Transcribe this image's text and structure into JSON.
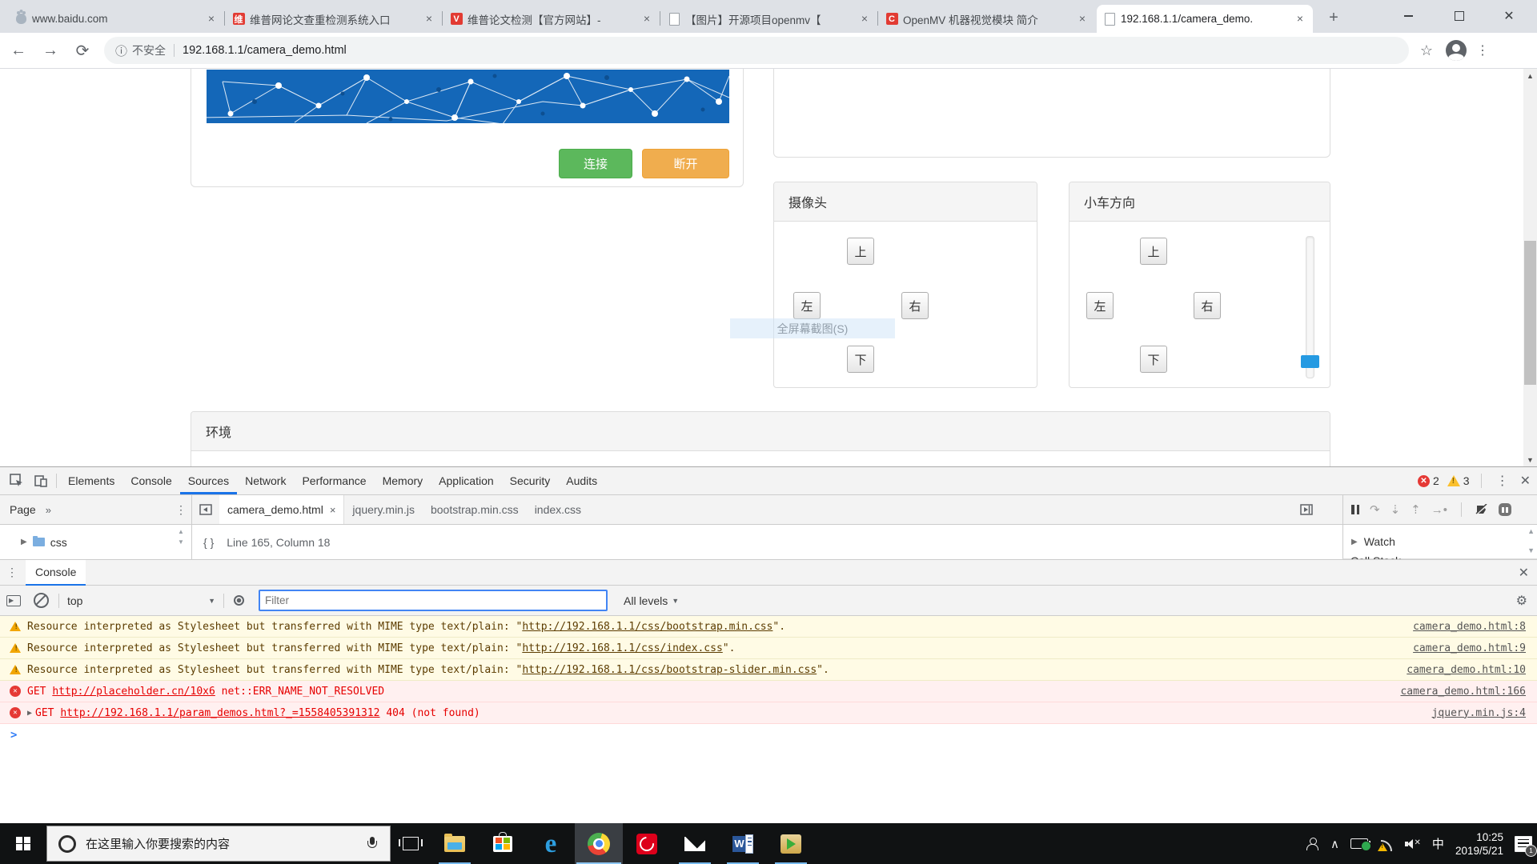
{
  "browser": {
    "tabs": [
      {
        "title": "www.baidu.com",
        "fav": ""
      },
      {
        "title": "维普网论文查重检测系统入口",
        "fav": "维"
      },
      {
        "title": "维普论文检测【官方网站】-",
        "fav": "V"
      },
      {
        "title": "【图片】开源项目openmv【",
        "fav": ""
      },
      {
        "title": "OpenMV 机器视觉模块 简介",
        "fav": "C"
      },
      {
        "title": "192.168.1.1/camera_demo.",
        "fav": ""
      }
    ],
    "address": {
      "security_label": "不安全",
      "url": "192.168.1.1/camera_demo.html"
    }
  },
  "page": {
    "connect_card": {
      "connect_label": "连接",
      "disconnect_label": "断开"
    },
    "camera_panel": {
      "title": "摄像头",
      "up": "上",
      "left": "左",
      "right": "右",
      "down": "下"
    },
    "car_panel": {
      "title": "小车方向",
      "up": "上",
      "left": "左",
      "right": "右",
      "down": "下"
    },
    "env_panel": {
      "title": "环境"
    },
    "ghost_tooltip": "全屏幕截图(S)"
  },
  "devtools": {
    "tabs": [
      "Elements",
      "Console",
      "Sources",
      "Network",
      "Performance",
      "Memory",
      "Application",
      "Security",
      "Audits"
    ],
    "error_count": "2",
    "warning_count": "3",
    "navigator": {
      "pane_tab": "Page",
      "more_chevron": "»",
      "tree_item": "css"
    },
    "file_tabs": [
      "camera_demo.html",
      "jquery.min.js",
      "bootstrap.min.css",
      "index.css"
    ],
    "editor_status": "Line 165, Column 18",
    "watch_label": "Watch",
    "callstack_label": "Call Stack",
    "drawer_tab": "Console",
    "console_toolbar": {
      "context": "top",
      "filter_placeholder": "Filter",
      "levels": "All levels"
    },
    "messages": [
      {
        "type": "warning",
        "before": "Resource interpreted as Stylesheet but transferred with MIME type text/plain: \"",
        "link": "http://192.168.1.1/css/bootstrap.min.css",
        "after": "\".",
        "source": "camera_demo.html:8"
      },
      {
        "type": "warning",
        "before": "Resource interpreted as Stylesheet but transferred with MIME type text/plain: \"",
        "link": "http://192.168.1.1/css/index.css",
        "after": "\".",
        "source": "camera_demo.html:9"
      },
      {
        "type": "warning",
        "before": "Resource interpreted as Stylesheet but transferred with MIME type text/plain: \"",
        "link": "http://192.168.1.1/css/bootstrap-slider.min.css",
        "after": "\".",
        "source": "camera_demo.html:10"
      },
      {
        "type": "error",
        "before": "GET ",
        "link": "http://placeholder.cn/10x6",
        "after": " net::ERR_NAME_NOT_RESOLVED",
        "source": "camera_demo.html:166"
      },
      {
        "type": "error",
        "before": "GET ",
        "link": "http://192.168.1.1/param_demos.html?_=1558405391312",
        "after": " 404 (not found)",
        "source": "jquery.min.js:4"
      }
    ]
  },
  "taskbar": {
    "search_placeholder": "在这里输入你要搜索的内容",
    "ime_indicator": "中",
    "clock_time": "10:25",
    "clock_date": "2019/5/21",
    "action_badge": "1"
  },
  "colors": {
    "accent_blue": "#1a73e8",
    "btn_green": "#5cb85c",
    "btn_orange": "#f0ad4e",
    "error_red": "#e60000",
    "warn_bg": "#fffbe5"
  }
}
